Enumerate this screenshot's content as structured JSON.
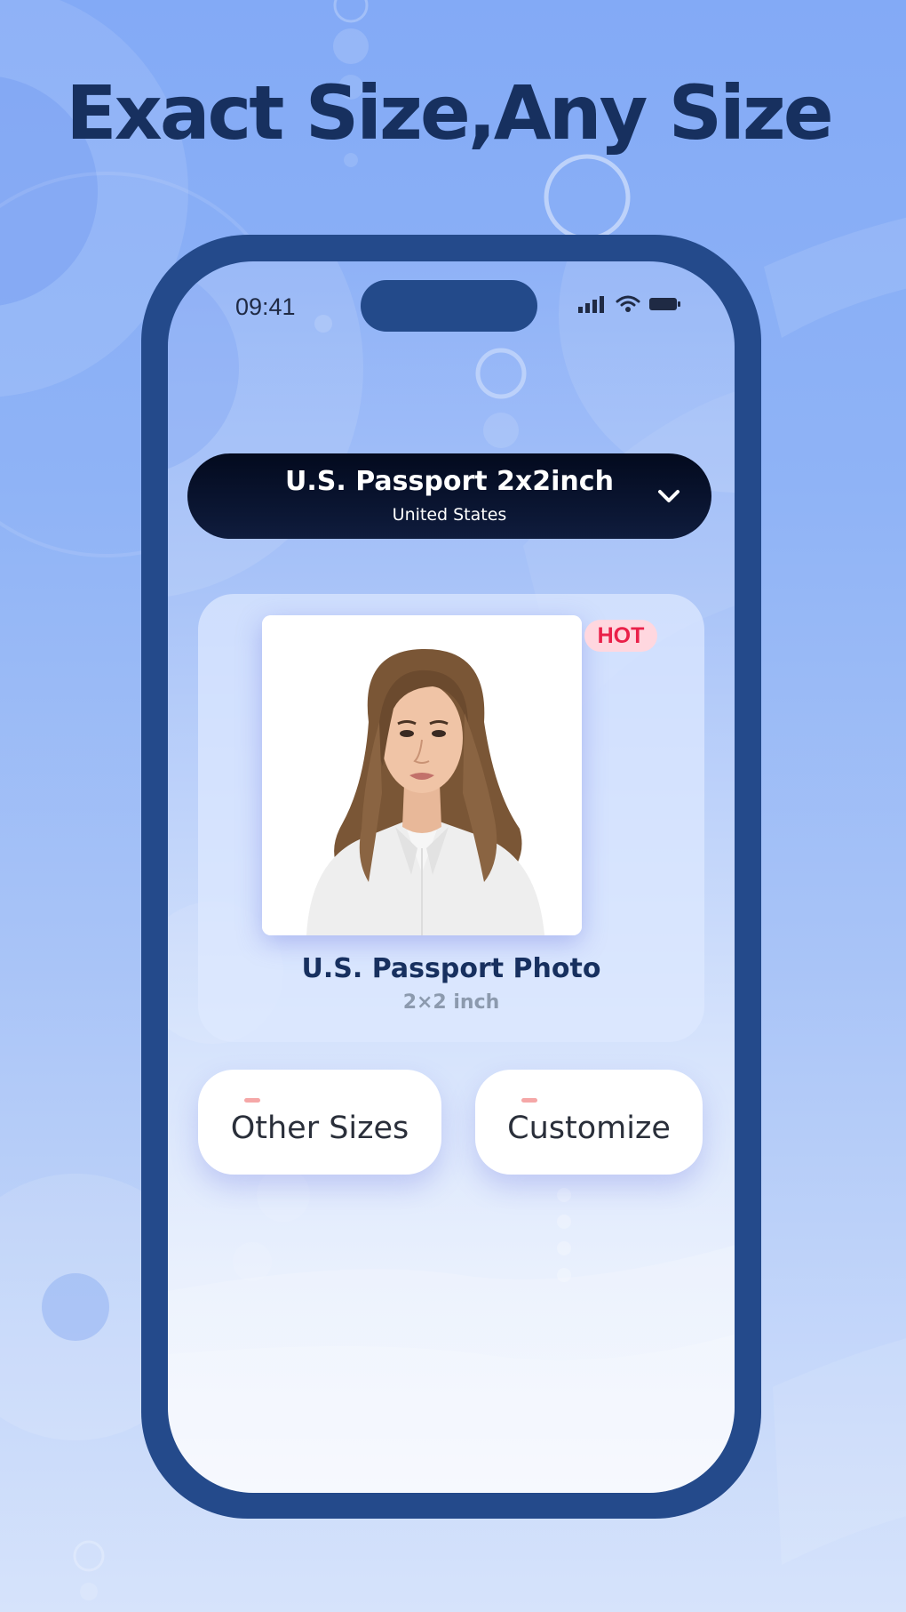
{
  "headline": "Exact Size,Any Size",
  "status_bar": {
    "time": "09:41",
    "icons": [
      "cellular-signal-icon",
      "wifi-icon",
      "battery-icon"
    ]
  },
  "size_selector": {
    "title": "U.S. Passport 2x2inch",
    "country": "United States",
    "icon": "chevron-down-icon"
  },
  "featured": {
    "badge": "HOT",
    "photo_alt": "passport-photo-portrait",
    "title": "U.S. Passport Photo",
    "size": "2×2 inch"
  },
  "options": [
    {
      "label": "Other Sizes"
    },
    {
      "label": "Customize"
    }
  ],
  "colors": {
    "background": "#8fb3f6",
    "phone_frame": "#244a8b",
    "headline": "#17305f",
    "selector": "#0a1430",
    "badge_text": "#ea2049",
    "badge_bg": "#ffd7df"
  }
}
